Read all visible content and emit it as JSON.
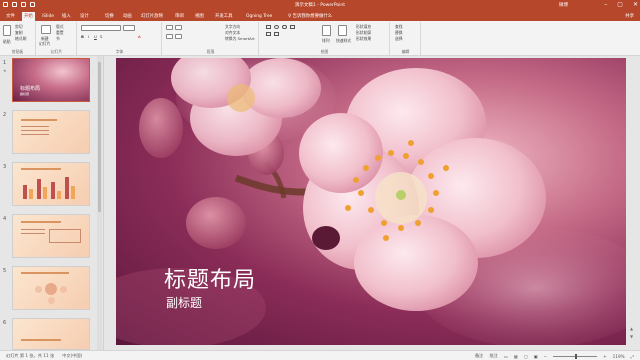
{
  "titlebar": {
    "title": "演示文稿1 - PowerPoint",
    "user": "微博",
    "minimize": "–",
    "restore": "▢",
    "close": "✕"
  },
  "ribbon_tabs": [
    "文件",
    "开始",
    "iSlide",
    "插入",
    "设计",
    "切换",
    "动画",
    "幻灯片放映",
    "审阅",
    "视图",
    "开发工具",
    "Ogning Tree",
    "♀ 告诉我你想要做什么"
  ],
  "active_tab": "开始",
  "share": "共享",
  "groups": {
    "clipboard": "剪贴板",
    "slides": "幻灯片",
    "font": "字体",
    "paragraph": "段落",
    "drawing": "绘图",
    "editing": "编辑"
  },
  "clipboard": {
    "paste": "粘贴",
    "cut": "剪切",
    "copy": "复制",
    "format": "格式刷"
  },
  "slides_group": {
    "new": "新建",
    "newsub": "幻灯片",
    "layout": "版式",
    "reset": "重置",
    "section": "节"
  },
  "paragraph": {
    "textdir": "文字方向",
    "align": "对齐文本",
    "smartart": "转换为 SmartArt"
  },
  "drawing": {
    "arrange": "排列",
    "quickstyles": "快速样式",
    "fill": "形状填充",
    "outline": "形状轮廓",
    "effect": "形状效果"
  },
  "editing": {
    "find": "查找",
    "replace": "替换",
    "select": "选择"
  },
  "thumbnails": [
    {
      "num": "1",
      "title": "标题布局",
      "subtitle": "副标题"
    },
    {
      "num": "2"
    },
    {
      "num": "3"
    },
    {
      "num": "4"
    },
    {
      "num": "5"
    },
    {
      "num": "6"
    }
  ],
  "slide": {
    "title": "标题布局",
    "subtitle": "副标题"
  },
  "statusbar": {
    "slide_info": "幻灯片 第 1 张，共 11 张",
    "language": "中文(中国)",
    "notes": "备注",
    "comments": "批注",
    "zoom": "119%"
  },
  "colors": {
    "accent": "#b7472a",
    "slide_dark": "#5b163c",
    "slide_light": "#f0b8c4"
  }
}
